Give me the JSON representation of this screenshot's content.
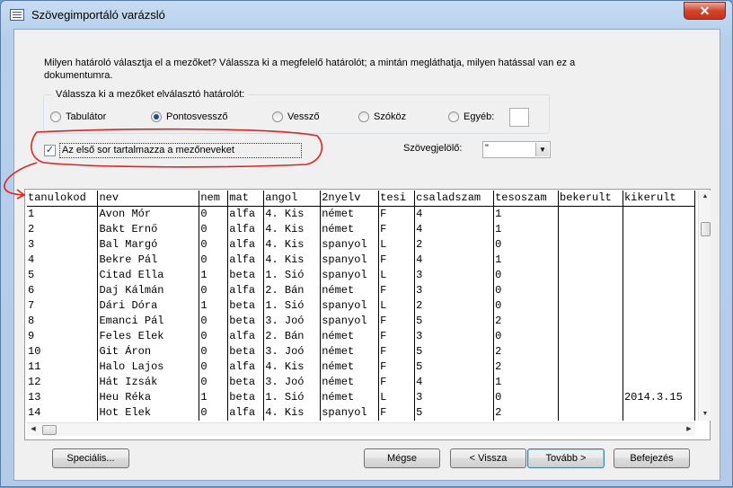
{
  "window": {
    "title": "Szövegimportáló varázsló",
    "close_glyph": "✕"
  },
  "instructions": "Milyen határoló választja el a mezőket? Válassza ki a megfelelő határolót; a mintán megláthatja, milyen hatással van ez a dokumentumra.",
  "delimiter_group": {
    "label": "Válassza ki a mezőket elválasztó határolót:",
    "options": [
      {
        "label": "Tabulátor",
        "checked": false
      },
      {
        "label": "Pontosvessző",
        "checked": true
      },
      {
        "label": "Vessző",
        "checked": false
      },
      {
        "label": "Szóköz",
        "checked": false
      },
      {
        "label": "Egyéb:",
        "checked": false
      }
    ],
    "other_value": ""
  },
  "first_row": {
    "label": "Az első sor tartalmazza a mezőneveket",
    "checked": true
  },
  "text_qualifier": {
    "label": "Szövegjelölő:",
    "value": "\""
  },
  "table": {
    "headers": [
      "tanulokod",
      "nev",
      "nem",
      "mat",
      "angol",
      "2nyelv",
      "tesi",
      "csaladszam",
      "tesoszam",
      "bekerult",
      "kikerult"
    ],
    "rows": [
      [
        "1",
        "Avon Mór",
        "0",
        "alfa",
        "4. Kis",
        "német",
        "F",
        "4",
        "1",
        "",
        ""
      ],
      [
        "2",
        "Bakt Ernő",
        "0",
        "alfa",
        "4. Kis",
        "német",
        "F",
        "4",
        "1",
        "",
        ""
      ],
      [
        "3",
        "Bal Margó",
        "0",
        "alfa",
        "4. Kis",
        "spanyol",
        "L",
        "2",
        "0",
        "",
        ""
      ],
      [
        "4",
        "Bekre Pál",
        "0",
        "alfa",
        "4. Kis",
        "spanyol",
        "F",
        "4",
        "1",
        "",
        ""
      ],
      [
        "5",
        "Citad Ella",
        "1",
        "beta",
        "1. Sió",
        "spanyol",
        "L",
        "3",
        "0",
        "",
        ""
      ],
      [
        "6",
        "Daj Kálmán",
        "0",
        "alfa",
        "2. Bán",
        "német",
        "F",
        "3",
        "0",
        "",
        ""
      ],
      [
        "7",
        "Dári Dóra",
        "1",
        "beta",
        "1. Sió",
        "spanyol",
        "L",
        "2",
        "0",
        "",
        ""
      ],
      [
        "8",
        "Emanci Pál",
        "0",
        "beta",
        "3. Joó",
        "spanyol",
        "F",
        "5",
        "2",
        "",
        ""
      ],
      [
        "9",
        "Feles Elek",
        "0",
        "alfa",
        "2. Bán",
        "német",
        "F",
        "3",
        "0",
        "",
        ""
      ],
      [
        "10",
        "Git Áron",
        "0",
        "beta",
        "3. Joó",
        "német",
        "F",
        "5",
        "2",
        "",
        ""
      ],
      [
        "11",
        "Halo Lajos",
        "0",
        "alfa",
        "4. Kis",
        "német",
        "F",
        "5",
        "2",
        "",
        ""
      ],
      [
        "12",
        "Hát Izsák",
        "0",
        "beta",
        "3. Joó",
        "német",
        "F",
        "4",
        "1",
        "",
        ""
      ],
      [
        "13",
        "Heu Réka",
        "1",
        "beta",
        "1. Sió",
        "német",
        "L",
        "3",
        "0",
        "",
        "2014.3.15"
      ],
      [
        "14",
        "Hot Elek",
        "0",
        "alfa",
        "4. Kis",
        "spanyol",
        "F",
        "5",
        "2",
        "",
        ""
      ]
    ]
  },
  "buttons": {
    "advanced": "Speciális...",
    "cancel": "Mégse",
    "back": "< Vissza",
    "next": "Tovább >",
    "finish": "Befejezés"
  },
  "colors": {
    "annotation": "#e32222",
    "accent": "#3c7fb1"
  }
}
